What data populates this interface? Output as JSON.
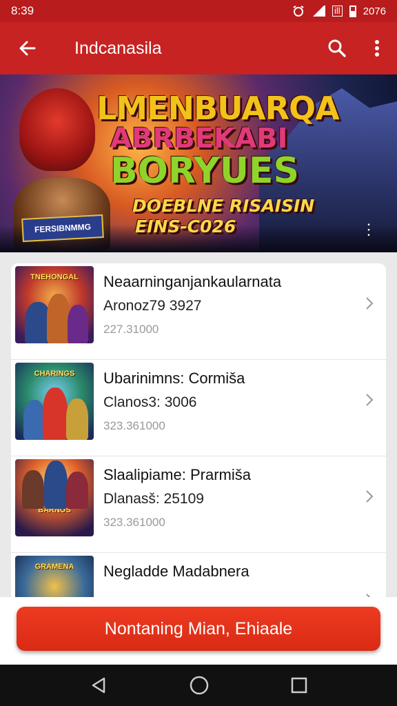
{
  "status_bar": {
    "time": "8:39",
    "network_label": "ill",
    "battery": "2076"
  },
  "app_bar": {
    "title": "Indcanasila"
  },
  "banner": {
    "line1": "LMENBUARQA",
    "line2": "ABRBEKABI",
    "line3": "BORYUES",
    "line4": "DOEBLNE RISAISIN",
    "line5": "EINS-C026",
    "logo_text": "FERSIBNMMG"
  },
  "list": {
    "items": [
      {
        "title": "Neaarninganjankaularnata",
        "subtitle": "Aronoz79 3927",
        "meta": "227.31000",
        "thumb_caption": "TNEHONGAL"
      },
      {
        "title": "Ubarinimns: Cormiša",
        "subtitle": "Clanos3: 3006",
        "meta": "323.361000",
        "thumb_caption": "CHARINGS"
      },
      {
        "title": "Slaalipiame: Prarmiša",
        "subtitle": "Dlanasš: 25109",
        "meta": "323.361000",
        "thumb_caption": "BARNOS"
      },
      {
        "title": "Negladde Madabnera",
        "subtitle": "",
        "meta": "",
        "thumb_caption": "GRAMENA"
      }
    ]
  },
  "cta": {
    "label": "Nontaning Mian, Ehiaale"
  },
  "colors": {
    "primary": "#c62322",
    "status": "#b81c1c",
    "cta": "#e3321c"
  }
}
